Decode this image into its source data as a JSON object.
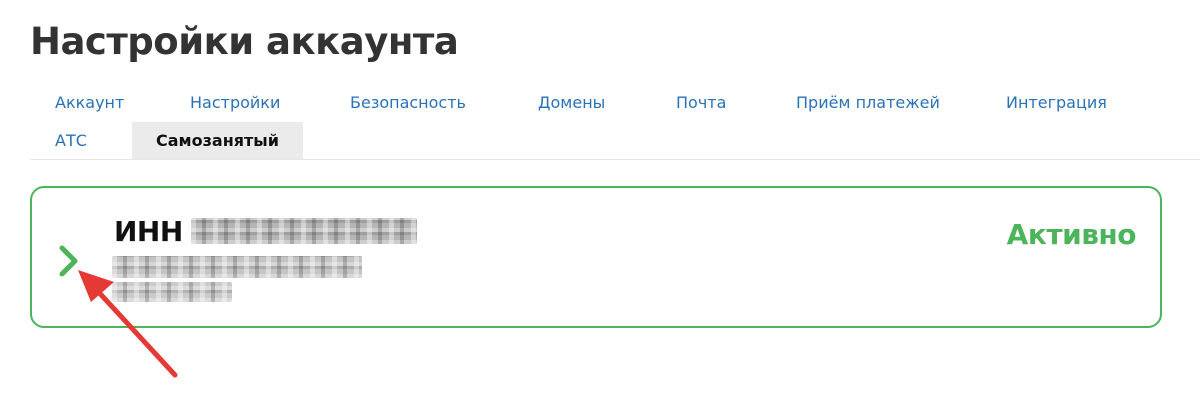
{
  "page": {
    "title": "Настройки аккаунта"
  },
  "tabs": [
    {
      "label": "Аккаунт",
      "active": false
    },
    {
      "label": "Настройки",
      "active": false
    },
    {
      "label": "Безопасность",
      "active": false
    },
    {
      "label": "Домены",
      "active": false
    },
    {
      "label": "Почта",
      "active": false
    },
    {
      "label": "Приём платежей",
      "active": false
    },
    {
      "label": "Интеграция",
      "active": false
    },
    {
      "label": "АТС",
      "active": false
    },
    {
      "label": "Самозанятый",
      "active": true
    }
  ],
  "card": {
    "inn_label": "ИНН",
    "status": "Активно",
    "expand_icon": "chevron-right-icon"
  },
  "colors": {
    "accent_green": "#4cb45a",
    "link_blue": "#2a72b8",
    "annotation_red": "#e53935",
    "active_tab_bg": "#ebebeb",
    "title_text": "#333333"
  }
}
